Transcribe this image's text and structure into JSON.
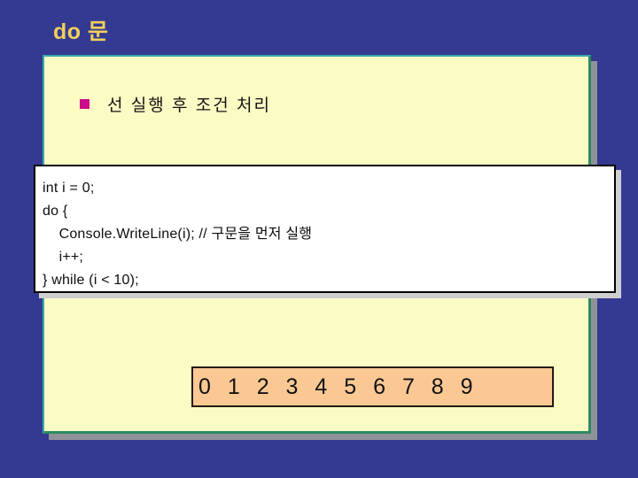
{
  "slide": {
    "title": "do 문",
    "bullet": {
      "marker": "square-bullet",
      "text": "선 실행 후 조건 처리"
    },
    "code": {
      "lines": [
        "int i = 0;",
        "do {",
        "    Console.WriteLine(i); // 구문을 먼저 실행",
        "    i++;",
        "} while (i < 10);"
      ]
    },
    "output": {
      "text": "0 1 2 3 4 5 6 7 8 9"
    }
  },
  "colors": {
    "background": "#343a91",
    "title_text": "#f2cf5b",
    "panel_fill": "#fbfbc4",
    "panel_border_light": "#3aa8a8",
    "panel_border_dark": "#2c8a62",
    "panel_shadow": "#8f9298",
    "bullet_marker": "#cc0b8a",
    "code_fill": "#ffffff",
    "code_border": "#000000",
    "code_shadow": "#cfcfcf",
    "output_fill": "#fbc894",
    "output_border": "#241a14",
    "body_text": "#141414"
  }
}
